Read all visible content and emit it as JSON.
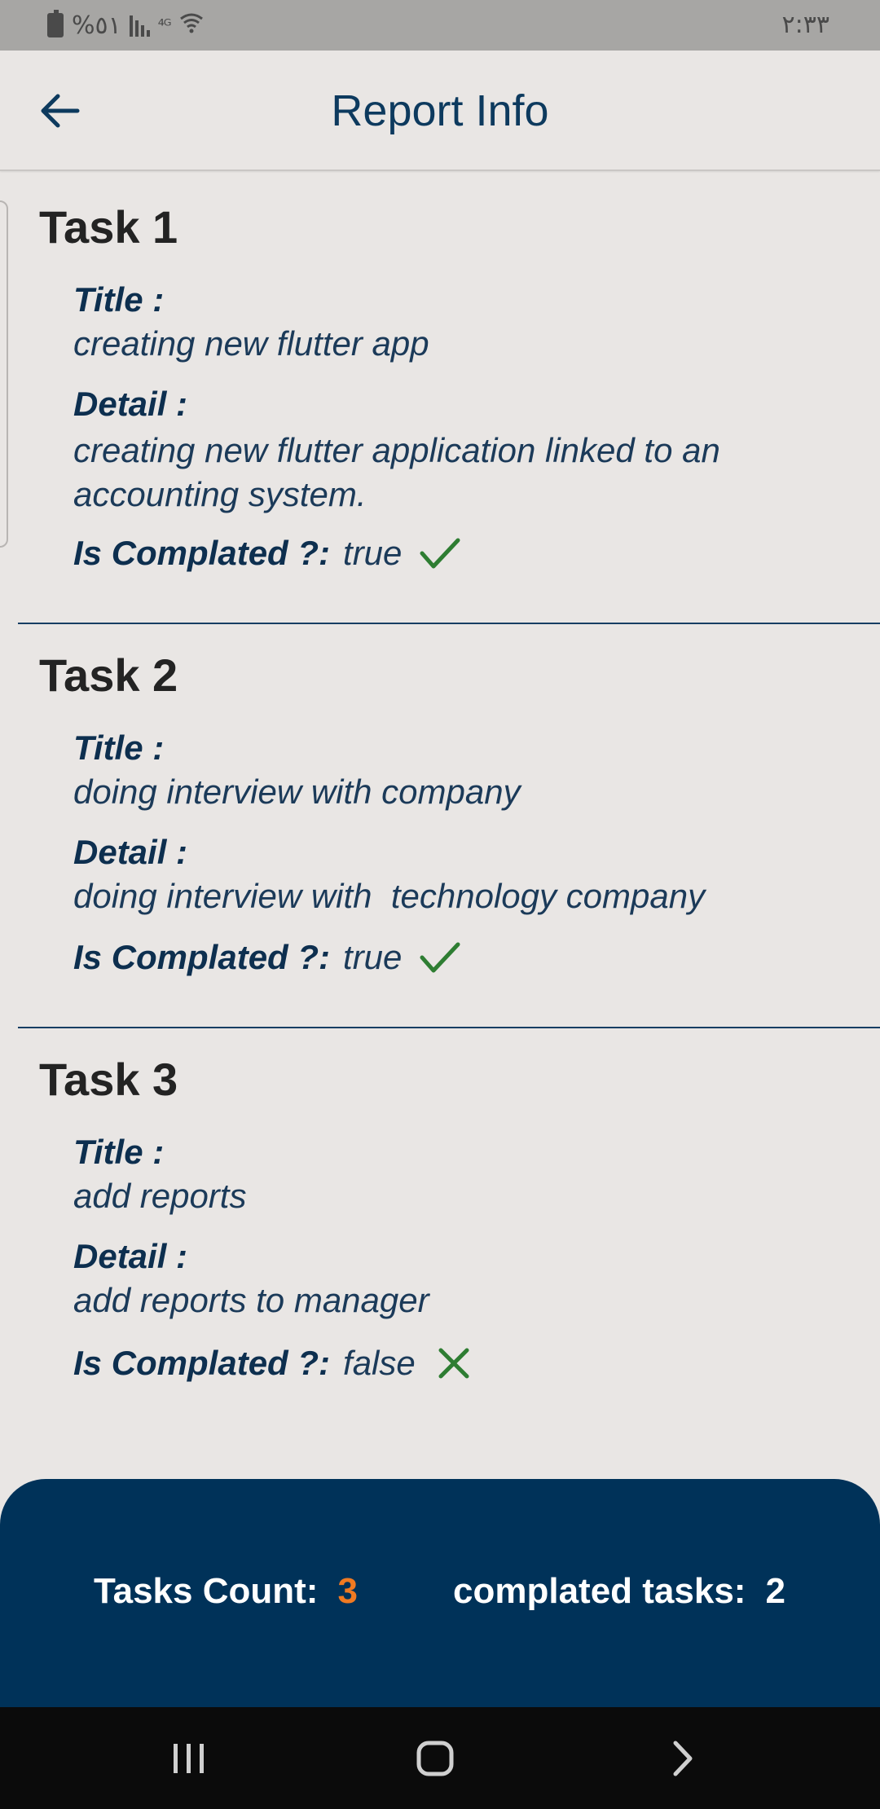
{
  "status_bar": {
    "battery_text": "%٥١",
    "time": "٢:٣٣",
    "icons": [
      "battery-charging-icon",
      "signal-bars-icon",
      "no-signal-icon",
      "wifi-icon"
    ]
  },
  "app_bar": {
    "title": "Report Info",
    "back_icon": "arrow-left-icon"
  },
  "tasks": [
    {
      "heading": "Task 1",
      "title_label": "Title :",
      "title": "creating new flutter app",
      "detail_label": "Detail :",
      "detail": "creating new flutter application linked to an accounting system.",
      "completed_label": "Is Complated ?:",
      "completed": "true",
      "status_icon": "check-icon"
    },
    {
      "heading": "Task 2",
      "title_label": "Title :",
      "title": "doing interview with company",
      "detail_label": "Detail :",
      "detail": "doing interview with  technology company",
      "completed_label": "Is Complated ?:",
      "completed": "true",
      "status_icon": "check-icon"
    },
    {
      "heading": "Task 3",
      "title_label": "Title :",
      "title": "add reports",
      "detail_label": "Detail :",
      "detail": "add reports to manager",
      "completed_label": "Is Complated ?:",
      "completed": "false",
      "status_icon": "close-icon"
    }
  ],
  "summary": {
    "tasks_count_label": "Tasks Count:",
    "tasks_count": "3",
    "completed_label": "complated tasks:",
    "completed_count": "2"
  },
  "colors": {
    "primary": "#003259",
    "accent": "#f07a22",
    "success": "#2e7d32",
    "background": "#e9e6e4"
  },
  "nav_bar": {
    "icons": [
      "recent-apps-icon",
      "home-icon",
      "back-chevron-icon"
    ]
  }
}
